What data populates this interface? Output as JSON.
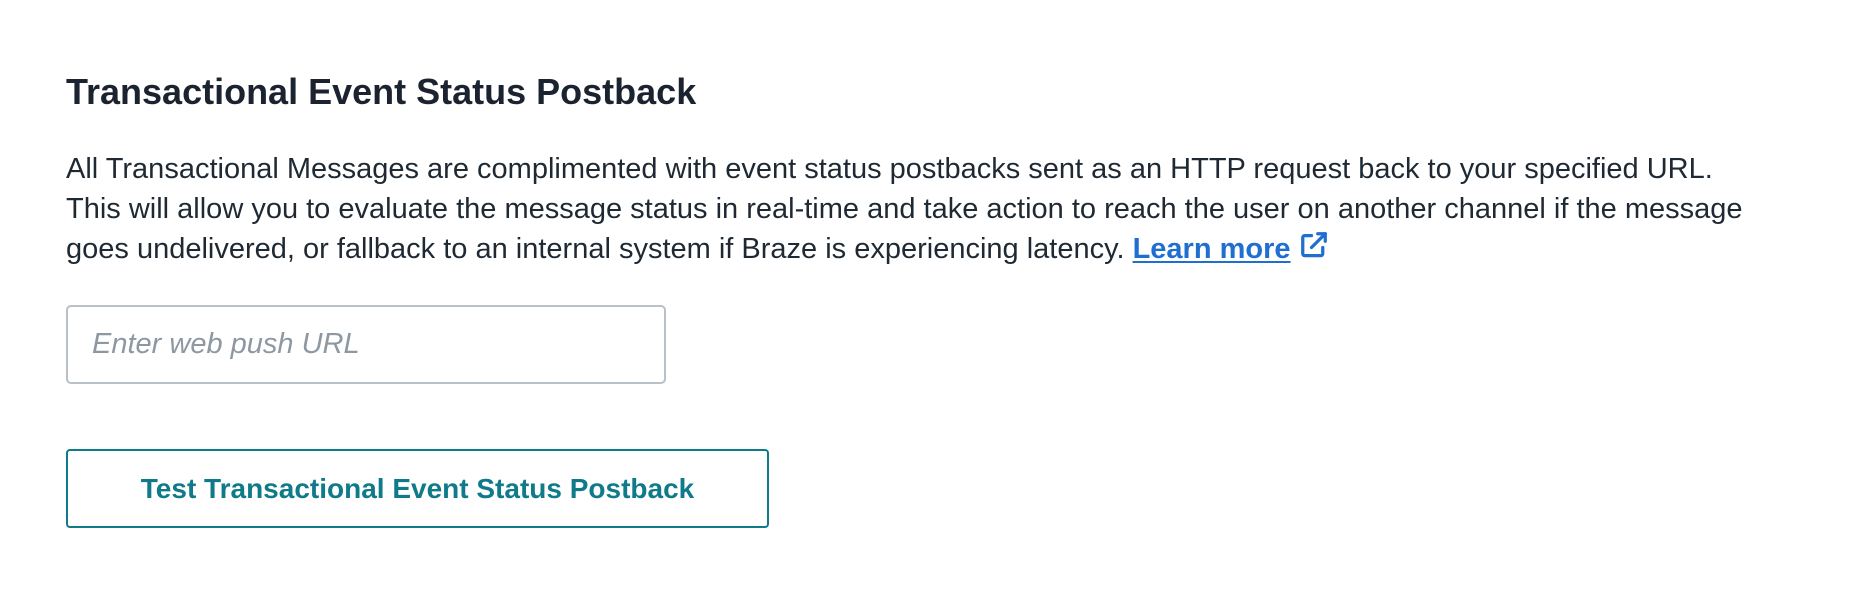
{
  "postback": {
    "title": "Transactional Event Status Postback",
    "description": "All Transactional Messages are complimented with event status postbacks sent as an HTTP request back to your specified URL. This will allow you to evaluate the message status in real-time and take action to reach the user on another channel if the message goes undelivered, or fallback to an internal system if Braze is experiencing latency.",
    "learn_more_label": "Learn more",
    "learn_more_icon": "external-link-icon",
    "url_input": {
      "value": "",
      "placeholder": "Enter web push URL"
    },
    "test_button_label": "Test Transactional Event Status Postback"
  },
  "colors": {
    "link": "#1f6fd1",
    "accent": "#0f7a89",
    "text": "#1f2933",
    "input_border": "#b8c0c8",
    "placeholder": "#8d98a3"
  }
}
